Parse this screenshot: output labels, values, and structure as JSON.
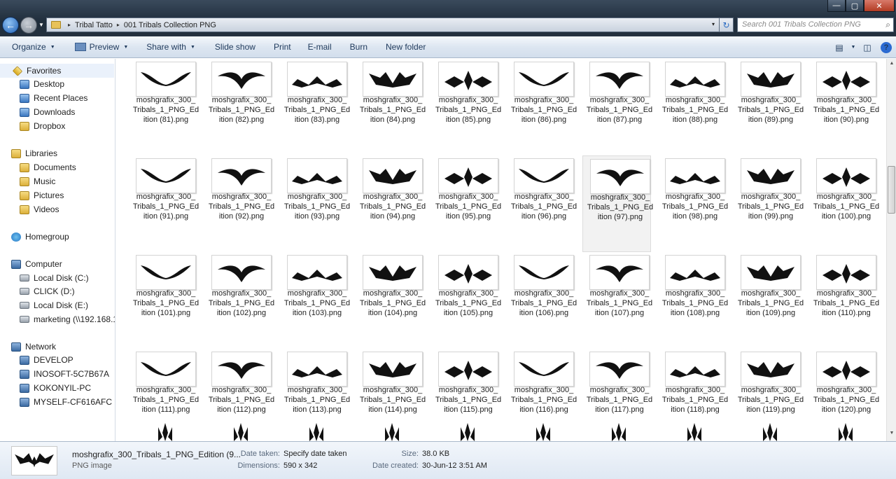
{
  "window": {
    "minimize_icon": "minimize-icon",
    "maximize_icon": "maximize-icon",
    "close_icon": "close-icon",
    "min_glyph": "—",
    "max_glyph": "▢",
    "close_glyph": "✕"
  },
  "address": {
    "crumbs": [
      "Tribal Tatto",
      "001 Tribals Collection PNG"
    ],
    "separator": "▸",
    "dropdown": "▾",
    "refresh": "↻"
  },
  "search": {
    "placeholder": "Search 001 Tribals Collection PNG",
    "icon": "⌕"
  },
  "toolbar": {
    "items": [
      "Organize",
      "Preview",
      "Share with",
      "Slide show",
      "Print",
      "E-mail",
      "Burn",
      "New folder"
    ],
    "dropdown_arrow": "▼",
    "help": "?",
    "view_glyph": "▤",
    "pane_glyph": "◫"
  },
  "sidebar": {
    "favorites": {
      "label": "Favorites",
      "items": [
        "Desktop",
        "Recent Places",
        "Downloads",
        "Dropbox"
      ]
    },
    "libraries": {
      "label": "Libraries",
      "items": [
        "Documents",
        "Music",
        "Pictures",
        "Videos"
      ]
    },
    "homegroup": {
      "label": "Homegroup"
    },
    "computer": {
      "label": "Computer",
      "items": [
        "Local Disk (C:)",
        "CLICK (D:)",
        "Local Disk (E:)",
        "marketing (\\\\192.168.1."
      ]
    },
    "network": {
      "label": "Network",
      "items": [
        "DEVELOP",
        "INOSOFT-5C7B67A",
        "KOKONYIL-PC",
        "MYSELF-CF616AFC"
      ]
    }
  },
  "files": {
    "prefix_line1": "moshgrafix_300_",
    "prefix_line2": "Tribals_1_PNG_Ed",
    "numbers": [
      81,
      82,
      83,
      84,
      85,
      86,
      87,
      88,
      89,
      90,
      91,
      92,
      93,
      94,
      95,
      96,
      97,
      98,
      99,
      100,
      101,
      102,
      103,
      104,
      105,
      106,
      107,
      108,
      109,
      110,
      111,
      112,
      113,
      114,
      115,
      116,
      117,
      118,
      119,
      120
    ],
    "selected": 97
  },
  "details": {
    "filename": "moshgrafix_300_Tribals_1_PNG_Edition (9...",
    "type": "PNG image",
    "date_taken_label": "Date taken:",
    "date_taken_value": "Specify date taken",
    "dimensions_label": "Dimensions:",
    "dimensions_value": "590 x 342",
    "size_label": "Size:",
    "size_value": "38.0 KB",
    "date_created_label": "Date created:",
    "date_created_value": "30-Jun-12 3:51 AM"
  },
  "scroll": {
    "up": "▲",
    "down": "▼"
  }
}
